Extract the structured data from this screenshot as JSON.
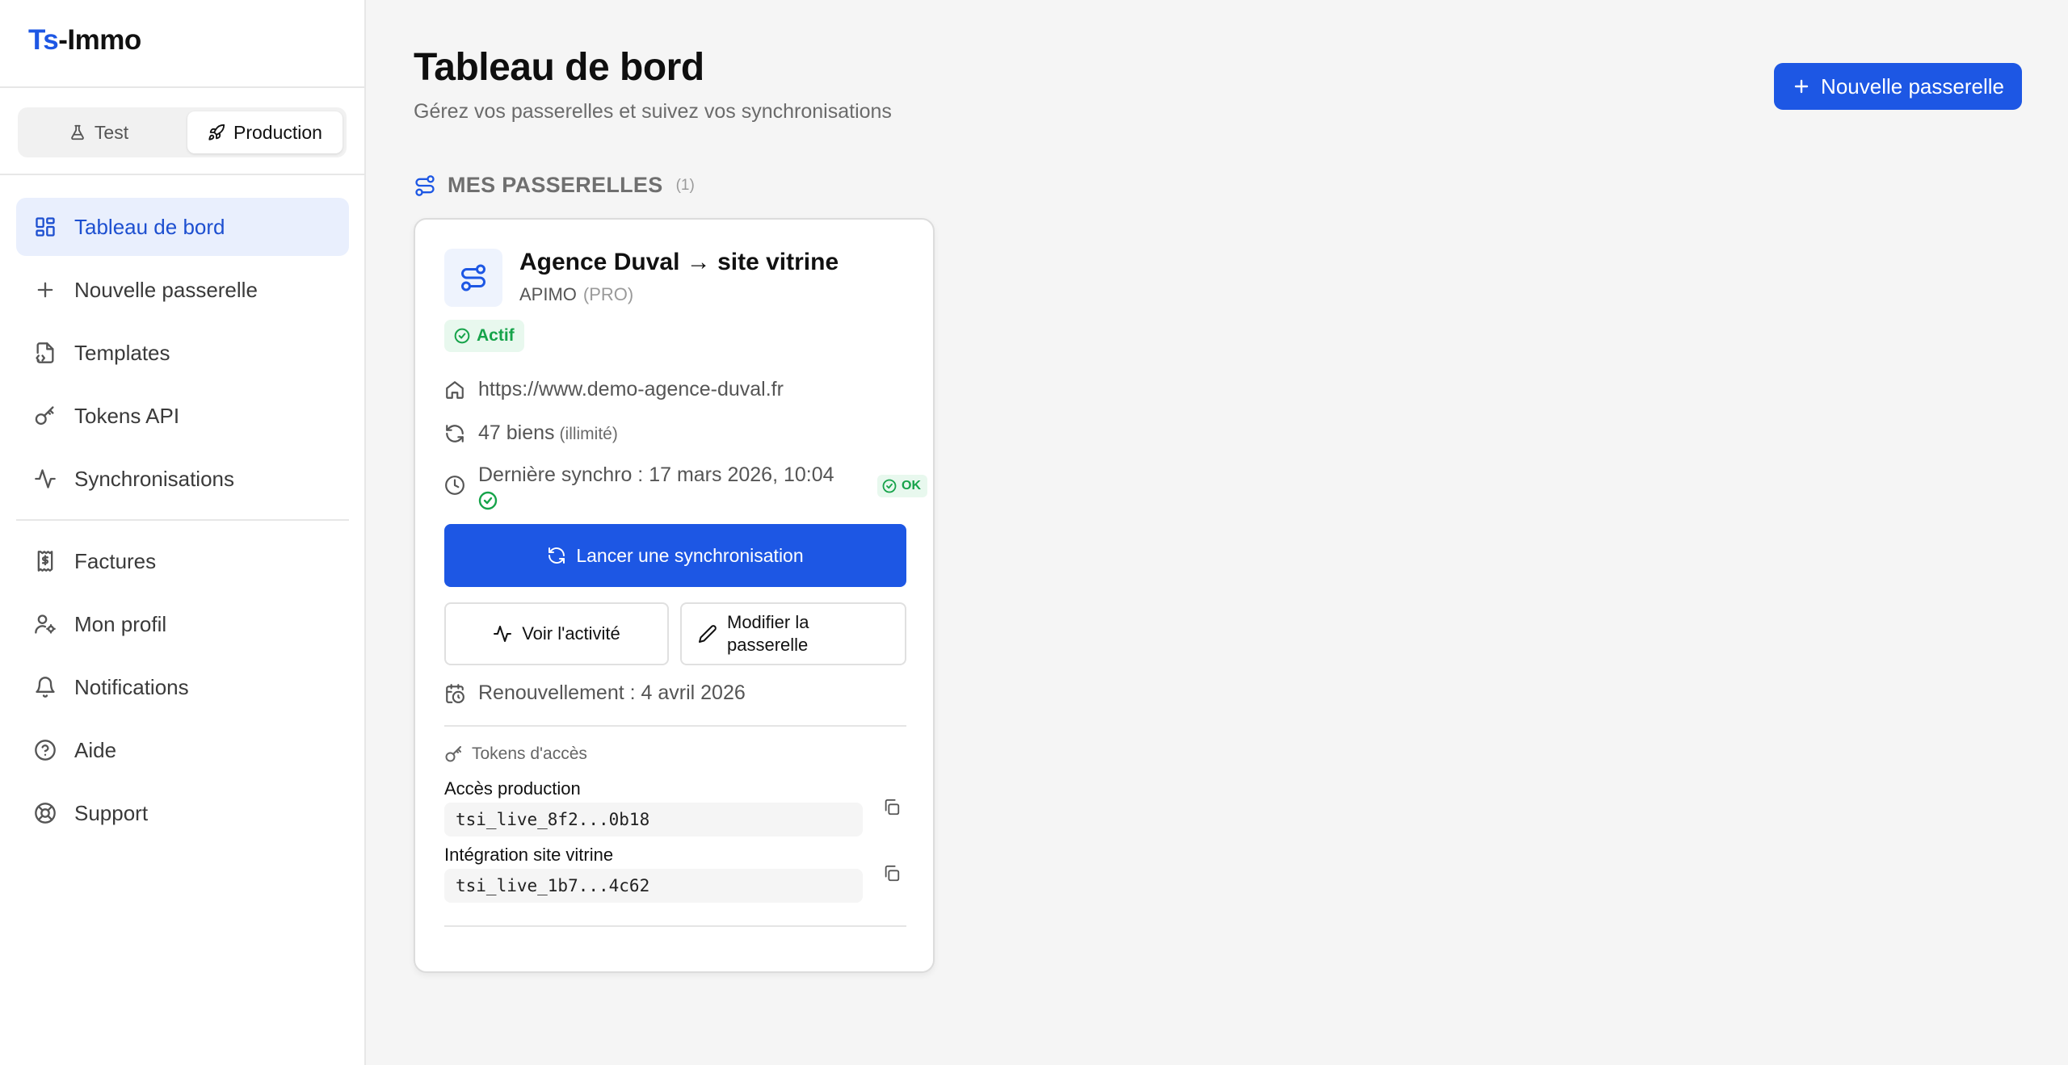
{
  "app": {
    "logo_prefix": "Ts",
    "logo_suffix": "-Immo"
  },
  "env_toggle": {
    "test_label": "Test",
    "production_label": "Production",
    "selected": "Production"
  },
  "sidebar": {
    "items": [
      {
        "label": "Tableau de bord",
        "icon": "dashboard-icon",
        "active": true
      },
      {
        "label": "Nouvelle passerelle",
        "icon": "plus-icon"
      },
      {
        "label": "Templates",
        "icon": "file-code-icon"
      },
      {
        "label": "Tokens API",
        "icon": "key-icon"
      },
      {
        "label": "Synchronisations",
        "icon": "activity-icon"
      },
      {
        "label": "Factures",
        "icon": "receipt-icon"
      },
      {
        "label": "Mon profil",
        "icon": "user-gear-icon"
      },
      {
        "label": "Notifications",
        "icon": "bell-icon"
      },
      {
        "label": "Aide",
        "icon": "help-circle-icon"
      },
      {
        "label": "Support",
        "icon": "lifebuoy-icon"
      }
    ]
  },
  "header": {
    "title": "Tableau de bord",
    "subtitle": "Gérez vos passerelles et suivez vos synchronisations",
    "new_button_label": "Nouvelle passerelle"
  },
  "section": {
    "title": "MES PASSERELLES",
    "count": "(1)"
  },
  "card": {
    "title": "Agence Duval → site vitrine",
    "source": "APIMO",
    "tier": "(PRO)",
    "status": "Actif",
    "website": "https://www.demo-agence-duval.fr",
    "properties": "47 biens",
    "properties_limit": "(illimité)",
    "last_sync": "Dernière synchro : 17 mars 2026, 10:04",
    "last_sync_status": "OK",
    "sync_button": "Lancer une synchronisation",
    "activity_button": "Voir l'activité",
    "edit_button": "Modifier la passerelle",
    "renewal": "Renouvellement : 4 avril 2026",
    "tokens_title": "Tokens d'accès",
    "tokens": [
      {
        "label": "Accès production",
        "value": "tsi_live_8f2...0b18"
      },
      {
        "label": "Intégration site vitrine",
        "value": "tsi_live_1b7...4c62"
      }
    ]
  },
  "colors": {
    "accent": "#1d57e4",
    "success": "#16a34a",
    "active_bg": "#e9effd"
  }
}
